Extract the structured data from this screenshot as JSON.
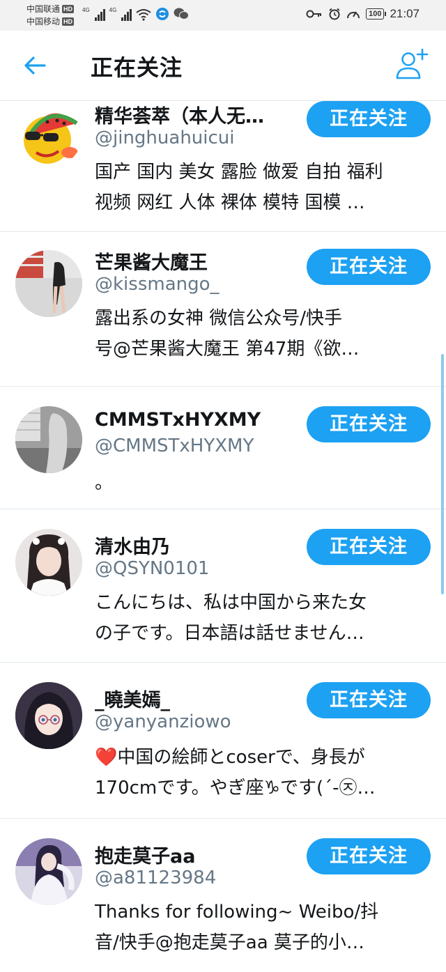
{
  "status_bar": {
    "carrier1": "中国联通",
    "carrier2": "中国移动",
    "hd": "HD",
    "net1": "4G",
    "net2": "4G",
    "battery": "100",
    "time": "21:07"
  },
  "header": {
    "title": "正在关注"
  },
  "accent_color": "#1da1f2",
  "users": [
    {
      "name": "精华荟萃（本人无…",
      "handle": "@jinghuahuicui",
      "bio_line1": "国产 国内 美女 露脸 做爱 自拍 福利",
      "bio_line2": "视频 网红 人体 裸体 模特 国模 …",
      "button": "正在关注"
    },
    {
      "name": "芒果酱大魔王",
      "handle": "@kissmango_",
      "bio_line1": "露出系の女神  微信公众号/快手",
      "bio_line2": "号@芒果酱大魔王 第47期《欲…",
      "button": "正在关注"
    },
    {
      "name": "CMMSTxHYXMY",
      "handle": "@CMMSTxHYXMY",
      "bio_line1": "。",
      "bio_line2": "",
      "button": "正在关注"
    },
    {
      "name": "清水由乃",
      "handle": "@QSYN0101",
      "bio_line1": "こんにちは、私は中国から来た女",
      "bio_line2": "の子です。日本語は話せません…",
      "button": "正在关注"
    },
    {
      "name": "_曉美嫣_",
      "handle": "@yanyanziowo",
      "bio_line1": "❤️中国の絵師とcoserで、身長が",
      "bio_line2": "170cmです。やぎ座♑です(´-㉨…",
      "button": "正在关注"
    },
    {
      "name": "抱走莫子aa",
      "handle": "@a81123984",
      "bio_line1": "Thanks for following~ Weibo/抖",
      "bio_line2": "音/快手@抱走莫子aa 莫子的小…",
      "button": "正在关注"
    }
  ]
}
